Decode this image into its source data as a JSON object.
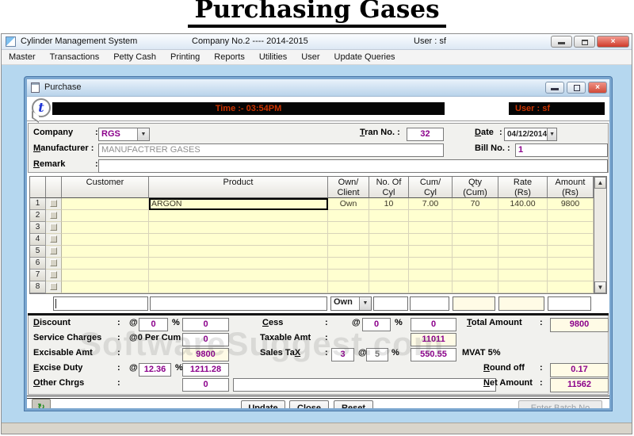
{
  "page": {
    "title": "Purchasing Gases"
  },
  "app": {
    "title": "Cylinder Management System",
    "company": "Company No.2 ---- 2014-2015",
    "user": "User : sf",
    "menu": [
      "Master",
      "Transactions",
      "Petty Cash",
      "Printing",
      "Reports",
      "Utilities",
      "User",
      "Update Queries"
    ]
  },
  "icons": {
    "close": "×",
    "dropdown": "▼",
    "scroll_up": "▲",
    "scroll_down": "▼",
    "recycle": "↻"
  },
  "win": {
    "title": "Purchase",
    "logo_letter": "t",
    "time_label": "Time :-  03:54PM",
    "user_label": "User : sf"
  },
  "form": {
    "colon": ":",
    "company_label": "Company",
    "company_value": "RGS",
    "tran_label": "Tran No. :",
    "tran_value": "32",
    "date_label": "Date",
    "date_value": "04/12/2014",
    "manufacturer_label": "Manufacturer :",
    "manufacturer_value": "MANUFACTRER GASES",
    "bill_label": "Bill No. :",
    "bill_value": "1",
    "remark_label": "Remark",
    "remark_value": ""
  },
  "grid": {
    "headers": {
      "customer": "Customer",
      "product": "Product",
      "own": "Own/\nClient",
      "cyl": "No. Of\nCyl",
      "cum": "Cum/\nCyl",
      "qty": "Qty\n(Cum)",
      "rate": "Rate\n(Rs)",
      "amount": "Amount\n(Rs)"
    },
    "rows": [
      {
        "num": "1",
        "customer": "",
        "product": "ARGON",
        "own": "Own",
        "cyl": "10",
        "cum": "7.00",
        "qty": "70",
        "rate": "140.00",
        "amount": "9800"
      },
      {
        "num": "2",
        "customer": "",
        "product": "",
        "own": "",
        "cyl": "",
        "cum": "",
        "qty": "",
        "rate": "",
        "amount": ""
      },
      {
        "num": "3",
        "customer": "",
        "product": "",
        "own": "",
        "cyl": "",
        "cum": "",
        "qty": "",
        "rate": "",
        "amount": ""
      },
      {
        "num": "4",
        "customer": "",
        "product": "",
        "own": "",
        "cyl": "",
        "cum": "",
        "qty": "",
        "rate": "",
        "amount": ""
      },
      {
        "num": "5",
        "customer": "",
        "product": "",
        "own": "",
        "cyl": "",
        "cum": "",
        "qty": "",
        "rate": "",
        "amount": ""
      },
      {
        "num": "6",
        "customer": "",
        "product": "",
        "own": "",
        "cyl": "",
        "cum": "",
        "qty": "",
        "rate": "",
        "amount": ""
      },
      {
        "num": "7",
        "customer": "",
        "product": "",
        "own": "",
        "cyl": "",
        "cum": "",
        "qty": "",
        "rate": "",
        "amount": ""
      },
      {
        "num": "8",
        "customer": "",
        "product": "",
        "own": "",
        "cyl": "",
        "cum": "",
        "qty": "",
        "rate": "",
        "amount": ""
      }
    ],
    "entry": {
      "customer": "",
      "product": "",
      "own": "Own",
      "cyl": "",
      "cum": "",
      "qty": "",
      "rate": "",
      "amount": ""
    }
  },
  "totals": {
    "colon": ":",
    "at": "@",
    "pct": "%",
    "discount_label": "Discount",
    "discount_pct": "0",
    "discount_value": "0",
    "service_label": "Service Charges",
    "service_rate": "@0  Per Cum",
    "service_value": "0",
    "excisable_label": "Excisable Amt",
    "excisable_value": "9800",
    "excise_label": "Excise Duty",
    "excise_pct": "12.36",
    "excise_value": "1211.28",
    "other_label": "Other Chrgs",
    "other_value": "0",
    "other_desc": "",
    "cess_label": "Cess",
    "cess_pct": "0",
    "cess_value": "0",
    "taxable_label": "Taxable Amt",
    "taxable_value": "11011",
    "salestax_label": "Sales TaX",
    "salestax_count": "3",
    "salestax_pct": "5",
    "salestax_value": "550.55",
    "mvat_label": "MVAT 5%",
    "total_label": "Total Amount",
    "total_value": "9800",
    "roundoff_label": "Round off",
    "roundoff_value": "0.17",
    "net_label": "Net Amount",
    "net_value": "11562"
  },
  "footer": {
    "update": "Update",
    "close": "Close",
    "reset": "Reset",
    "batch": "Enter Batch No"
  },
  "watermark": "SoftwareSuggest.com",
  "colors": {
    "value_text": "#8B008B",
    "alert_text": "#cc3300",
    "grid_bg": "#FFFFD0",
    "frame_blue": "#7aa6cf",
    "mdi_blue": "#b5d7ef"
  }
}
